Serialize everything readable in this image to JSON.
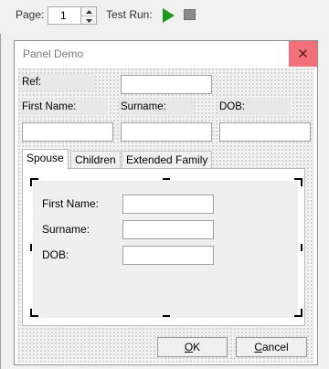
{
  "toolbar": {
    "page_label": "Page:",
    "page_value": "1",
    "test_run_label": "Test Run:",
    "play_icon": "play-icon",
    "stop_icon": "stop-icon"
  },
  "dialog": {
    "title": "Panel Demo",
    "close_glyph": "✕",
    "ref_label": "Ref:",
    "ref_value": "",
    "first_name_label": "First Name:",
    "first_name_value": "",
    "surname_label": "Surname:",
    "surname_value": "",
    "dob_label": "DOB:",
    "dob_value": "",
    "tabs": [
      {
        "label": "Spouse",
        "active": true
      },
      {
        "label": "Children",
        "active": false
      },
      {
        "label": "Extended Family",
        "active": false
      }
    ],
    "spouse": {
      "first_name_label": "First Name:",
      "first_name_value": "",
      "surname_label": "Surname:",
      "surname_value": "",
      "dob_label": "DOB:",
      "dob_value": ""
    },
    "ok_prefix": "",
    "ok_mnemonic": "O",
    "ok_rest": "K",
    "cancel_mnemonic": "C",
    "cancel_rest": "ancel"
  },
  "colors": {
    "close_bg": "#f1707a",
    "play": "#1d9a1d"
  }
}
